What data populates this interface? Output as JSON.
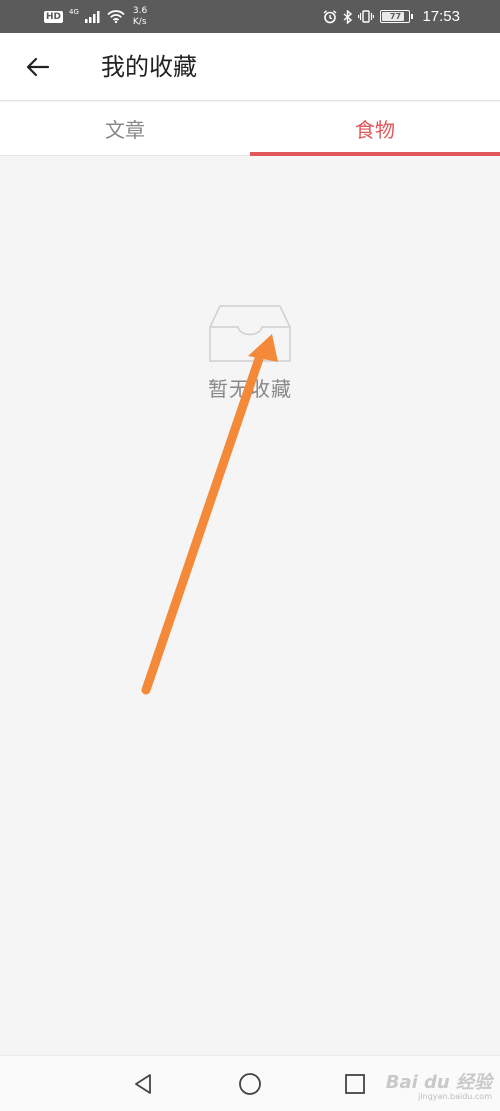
{
  "status_bar": {
    "hd": "HD",
    "network": "4G",
    "speed_value": "3.6",
    "speed_unit": "K/s",
    "battery_level": "77",
    "time": "17:53",
    "icons": [
      "signal-icon",
      "wifi-icon",
      "alarm-icon",
      "bluetooth-icon",
      "vibrate-icon",
      "battery-icon"
    ]
  },
  "header": {
    "back_icon": "back-arrow-icon",
    "title": "我的收藏"
  },
  "tabs": [
    {
      "label": "文章",
      "active": false
    },
    {
      "label": "食物",
      "active": true
    }
  ],
  "empty_state": {
    "icon": "empty-tray-icon",
    "text": "暂无收藏"
  },
  "nav_bar": {
    "icons": [
      "back-triangle-icon",
      "home-circle-icon",
      "recents-square-icon"
    ]
  },
  "watermark": {
    "main": "Bai du 经验",
    "sub": "jingyan.baidu.com"
  },
  "colors": {
    "accent": "#e0585c",
    "status_bar": "#5b5b5b",
    "annotation_arrow": "#f5893a",
    "background": "#f5f5f5"
  }
}
